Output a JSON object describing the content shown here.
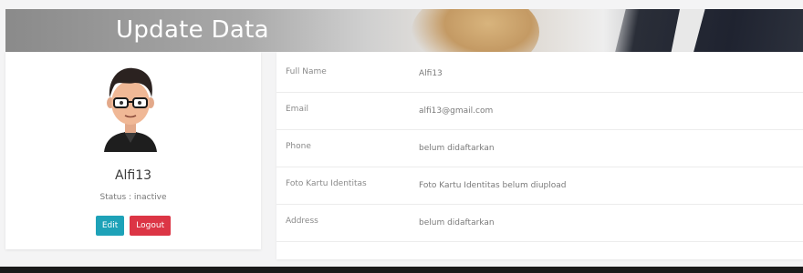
{
  "banner": {
    "title": "Update Data"
  },
  "profile": {
    "username": "Alfi13",
    "status": "Status : inactive",
    "edit_label": "Edit",
    "logout_label": "Logout"
  },
  "details": {
    "rows": [
      {
        "label": "Full Name",
        "value": "Alfi13"
      },
      {
        "label": "Email",
        "value": "alfi13@gmail.com"
      },
      {
        "label": "Phone",
        "value": "belum didaftarkan"
      },
      {
        "label": "Foto Kartu Identitas",
        "value": "Foto Kartu Identitas belum diupload"
      },
      {
        "label": "Address",
        "value": "belum didaftarkan"
      }
    ]
  },
  "colors": {
    "edit_button": "#1ea2b8",
    "logout_button": "#dc3545",
    "footer_bar": "#1a1a1a"
  }
}
